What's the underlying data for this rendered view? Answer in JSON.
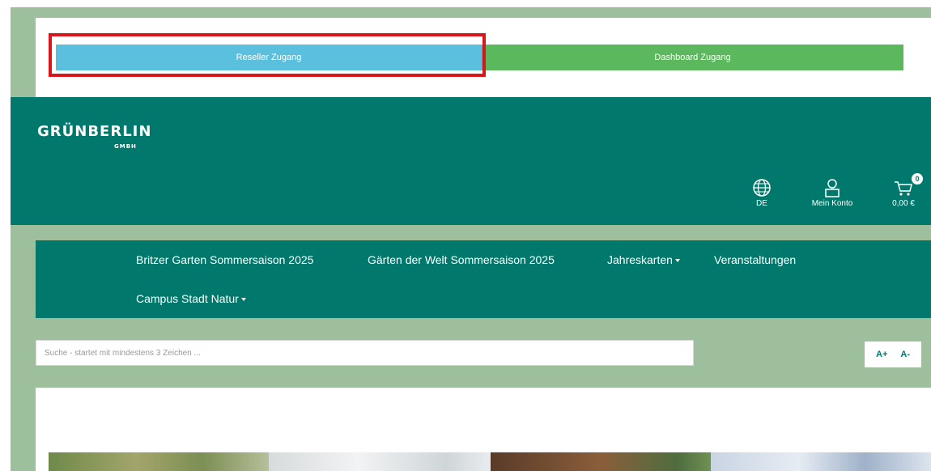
{
  "access": {
    "reseller_label": "Reseller Zugang",
    "dashboard_label": "Dashboard Zugang"
  },
  "brand": {
    "name": "GRÜNBERLIN",
    "suffix": "GMBH"
  },
  "header": {
    "language": "DE",
    "account_label": "Mein Konto",
    "cart_total": "0,00 €",
    "cart_count": "0"
  },
  "nav": {
    "items": [
      {
        "label": "Britzer Garten Sommersaison 2025"
      },
      {
        "label": "Gärten der Welt Sommersaison 2025"
      },
      {
        "label": "Jahreskarten"
      },
      {
        "label": "Veranstaltungen"
      },
      {
        "label": "Campus Stadt Natur"
      }
    ]
  },
  "search": {
    "placeholder": "Suche - startet mit mindestens 3 Zeichen ..."
  },
  "font_size": {
    "increase": "A+",
    "decrease": "A-"
  },
  "colors": {
    "page_bg": "#9dbf9b",
    "brand_green": "#00786b",
    "reseller_blue": "#5bc0de",
    "dashboard_green": "#5cb85c",
    "highlight_red": "#d9161c"
  }
}
